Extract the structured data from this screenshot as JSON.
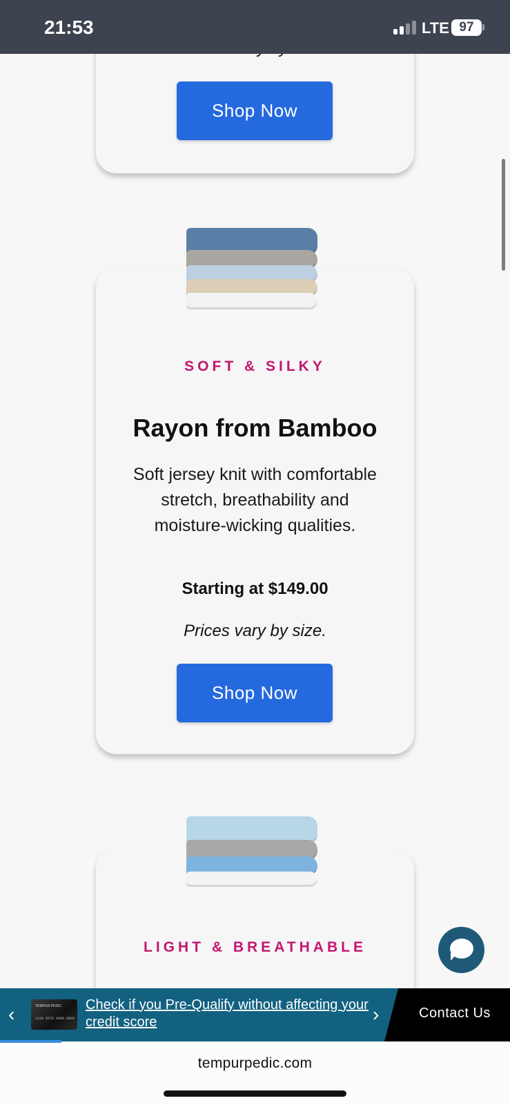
{
  "status_bar": {
    "time": "21:53",
    "network": "LTE",
    "battery": "97"
  },
  "top_card": {
    "price_note": "Prices vary by size.",
    "shop_label": "Shop Now"
  },
  "product_card": {
    "eyebrow": "SOFT & SILKY",
    "title": "Rayon from Bamboo",
    "description": "Soft jersey knit with comfortable stretch, breathability and moisture-wicking qualities.",
    "price": "Starting at $149.00",
    "price_note": "Prices vary by size.",
    "shop_label": "Shop Now",
    "sheet_colors": [
      "#5a7fa6",
      "#a9a6a1",
      "#bcd0e2",
      "#dccdb6",
      "#f2f2f2"
    ]
  },
  "next_card": {
    "eyebrow": "LIGHT & BREATHABLE",
    "sheet_colors": [
      "#b8d7e6",
      "#a9a8a8",
      "#7eb3e0",
      "#f3f3f3"
    ]
  },
  "promo_bar": {
    "card_brand": "TEMPUR-PEDIC",
    "card_number": "1234 5678 9000 0000",
    "link_text": "Check if you Pre-Qualify without affecting your credit score",
    "contact_label": "Contact Us"
  },
  "browser": {
    "url": "tempurpedic.com"
  },
  "colors": {
    "accent_blue": "#2569df",
    "eyebrow_pink": "#c2176f",
    "promo_teal": "#126180"
  }
}
